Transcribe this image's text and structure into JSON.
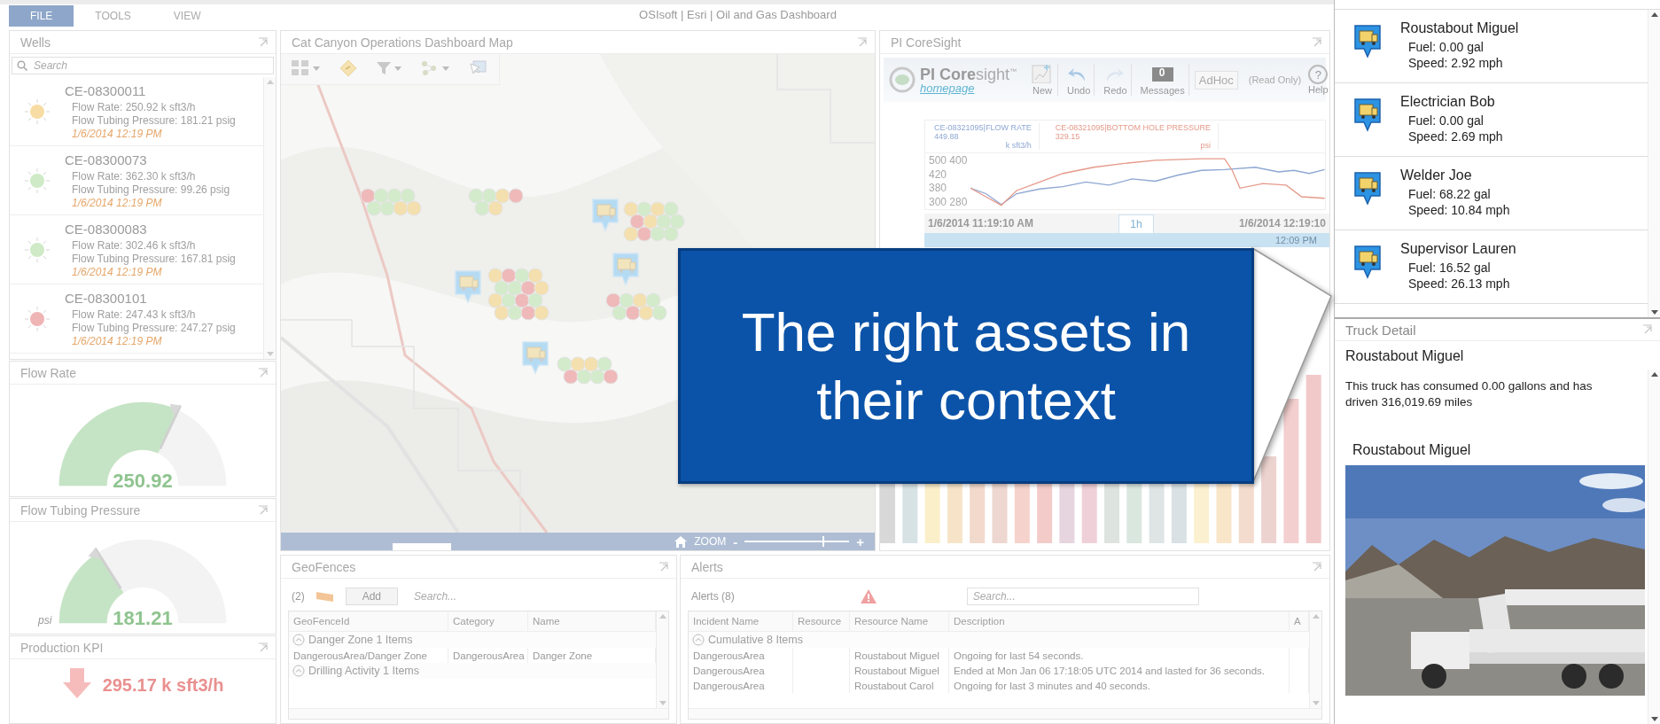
{
  "window": {
    "title": "OSIsoft | Esri | Oil and Gas Dashboard"
  },
  "menu_tabs": [
    {
      "label": "FILE",
      "selected": true
    },
    {
      "label": "TOOLS",
      "selected": false
    },
    {
      "label": "VIEW",
      "selected": false
    }
  ],
  "wells_panel": {
    "title": "Wells",
    "search": {
      "placeholder": "Search"
    },
    "wells": [
      {
        "id": "CE-08300011",
        "flow_rate": "Flow Rate: 250.92 k sft3/h",
        "pressure": "Flow Tubing Pressure: 181.21 psig",
        "timestamp": "1/6/2014 12:19 PM",
        "color": "#f7dca4"
      },
      {
        "id": "CE-08300073",
        "flow_rate": "Flow Rate: 362.30 k sft3/h",
        "pressure": "Flow Tubing Pressure: 99.26 psig",
        "timestamp": "1/6/2014 12:19 PM",
        "color": "#cfeac6"
      },
      {
        "id": "CE-08300083",
        "flow_rate": "Flow Rate: 302.46 k sft3/h",
        "pressure": "Flow Tubing Pressure: 167.81 psig",
        "timestamp": "1/6/2014 12:19 PM",
        "color": "#cfeac6"
      },
      {
        "id": "CE-08300101",
        "flow_rate": "Flow Rate: 247.43 k sft3/h",
        "pressure": "Flow Tubing Pressure: 247.27 psig",
        "timestamp": "1/6/2014 12:19 PM",
        "color": "#efb4b4"
      }
    ]
  },
  "flow_rate_panel": {
    "title": "Flow Rate",
    "value": "250.92",
    "level": 0.64
  },
  "pressure_panel": {
    "title": "Flow Tubing Pressure",
    "value": "181.21",
    "level": 0.32,
    "unit": "psi"
  },
  "kpi_panel": {
    "title": "Production KPI",
    "value": "295.17 k sft3/h"
  },
  "map_panel": {
    "title": "Cat Canyon Operations Dashboard Map",
    "zoom": {
      "label": "ZOOM",
      "minus": "-",
      "plus": "+",
      "level": 0.74
    }
  },
  "coresight_panel": {
    "title": "PI CoreSight",
    "logo": {
      "text": "PI Core",
      "suffix": "sight",
      "mark": "™",
      "link": "homepage"
    },
    "toolbar": [
      {
        "kind": "new",
        "label": "New"
      },
      {
        "kind": "undo",
        "label": "Undo"
      },
      {
        "kind": "redo",
        "label": "Redo"
      },
      {
        "kind": "messages",
        "label": "Messages",
        "badge": "0"
      }
    ],
    "display_select": "AdHoc",
    "mode": "(Read Only)",
    "help": {
      "glyph": "?",
      "label": "Help"
    },
    "trend": {
      "legend": [
        {
          "tag": "CE-08321095|FLOW RATE",
          "value": "449.88",
          "unit": "k sft3/h",
          "color": "#8ea7d3"
        },
        {
          "tag": "CE-08321095|BOTTOM HOLE PRESSURE",
          "value": "329.15",
          "unit": "psi",
          "color": "#e59a8a"
        }
      ],
      "axis_labels": [
        "500 400",
        "420",
        "380",
        "300 280"
      ]
    },
    "time_range": {
      "start": "1/6/2014 11:19:10 AM",
      "span": "1h",
      "end": "1/6/2014 12:19:10",
      "cursor": "12:09 PM"
    }
  },
  "geofences_panel": {
    "title": "GeoFences",
    "count": "(2)",
    "add_button": "Add",
    "search": {
      "placeholder": "Search..."
    },
    "columns": [
      "GeoFenceId",
      "Category",
      "Name"
    ],
    "groups": [
      {
        "label": "Danger Zone 1 Items",
        "expanded": true,
        "rows": [
          {
            "geofence_id": "DangerousArea/Danger Zone",
            "category": "DangerousArea",
            "name": "Danger Zone"
          }
        ]
      },
      {
        "label": "Drilling Activity 1 Items",
        "expanded": true
      }
    ]
  },
  "alerts_panel": {
    "title": "Alerts",
    "count": "Alerts (8)",
    "search": {
      "placeholder": "Search..."
    },
    "columns": [
      "Incident Name",
      "Resource",
      "Resource Name",
      "Description",
      "A"
    ],
    "groups": [
      {
        "label": "Cumulative 8 Items",
        "expanded": true,
        "rows": [
          {
            "incident_name": "DangerousArea",
            "resource_name": "Roustabout Miguel",
            "description": "Ongoing for last 54 seconds."
          },
          {
            "incident_name": "DangerousArea",
            "resource_name": "Roustabout Miguel",
            "description": "Ended at Mon Jan 06 17:18:05 UTC 2014 and lasted for 36 seconds."
          },
          {
            "incident_name": "DangerousArea",
            "resource_name": "Roustabout Carol",
            "description": "Ongoing for last 3 minutes and 40 seconds."
          }
        ]
      }
    ]
  },
  "trucks_panel": {
    "trucks": [
      {
        "name": "Roustabout Miguel",
        "fuel": "Fuel: 0.00 gal",
        "speed": "Speed: 2.92 mph"
      },
      {
        "name": "Electrician Bob",
        "fuel": "Fuel: 0.00 gal",
        "speed": "Speed: 2.69 mph"
      },
      {
        "name": "Welder Joe",
        "fuel": "Fuel: 68.22 gal",
        "speed": "Speed: 10.84 mph"
      },
      {
        "name": "Supervisor Lauren",
        "fuel": "Fuel: 16.52 gal",
        "speed": "Speed: 26.13 mph"
      }
    ]
  },
  "truck_detail_panel": {
    "title": "Truck Detail",
    "name": "Roustabout Miguel",
    "summary": "This truck has consumed 0.00 gallons and has driven 316,019.69 miles",
    "photo_caption": "Roustabout Miguel"
  },
  "callout": {
    "text": "The right assets in their context"
  }
}
